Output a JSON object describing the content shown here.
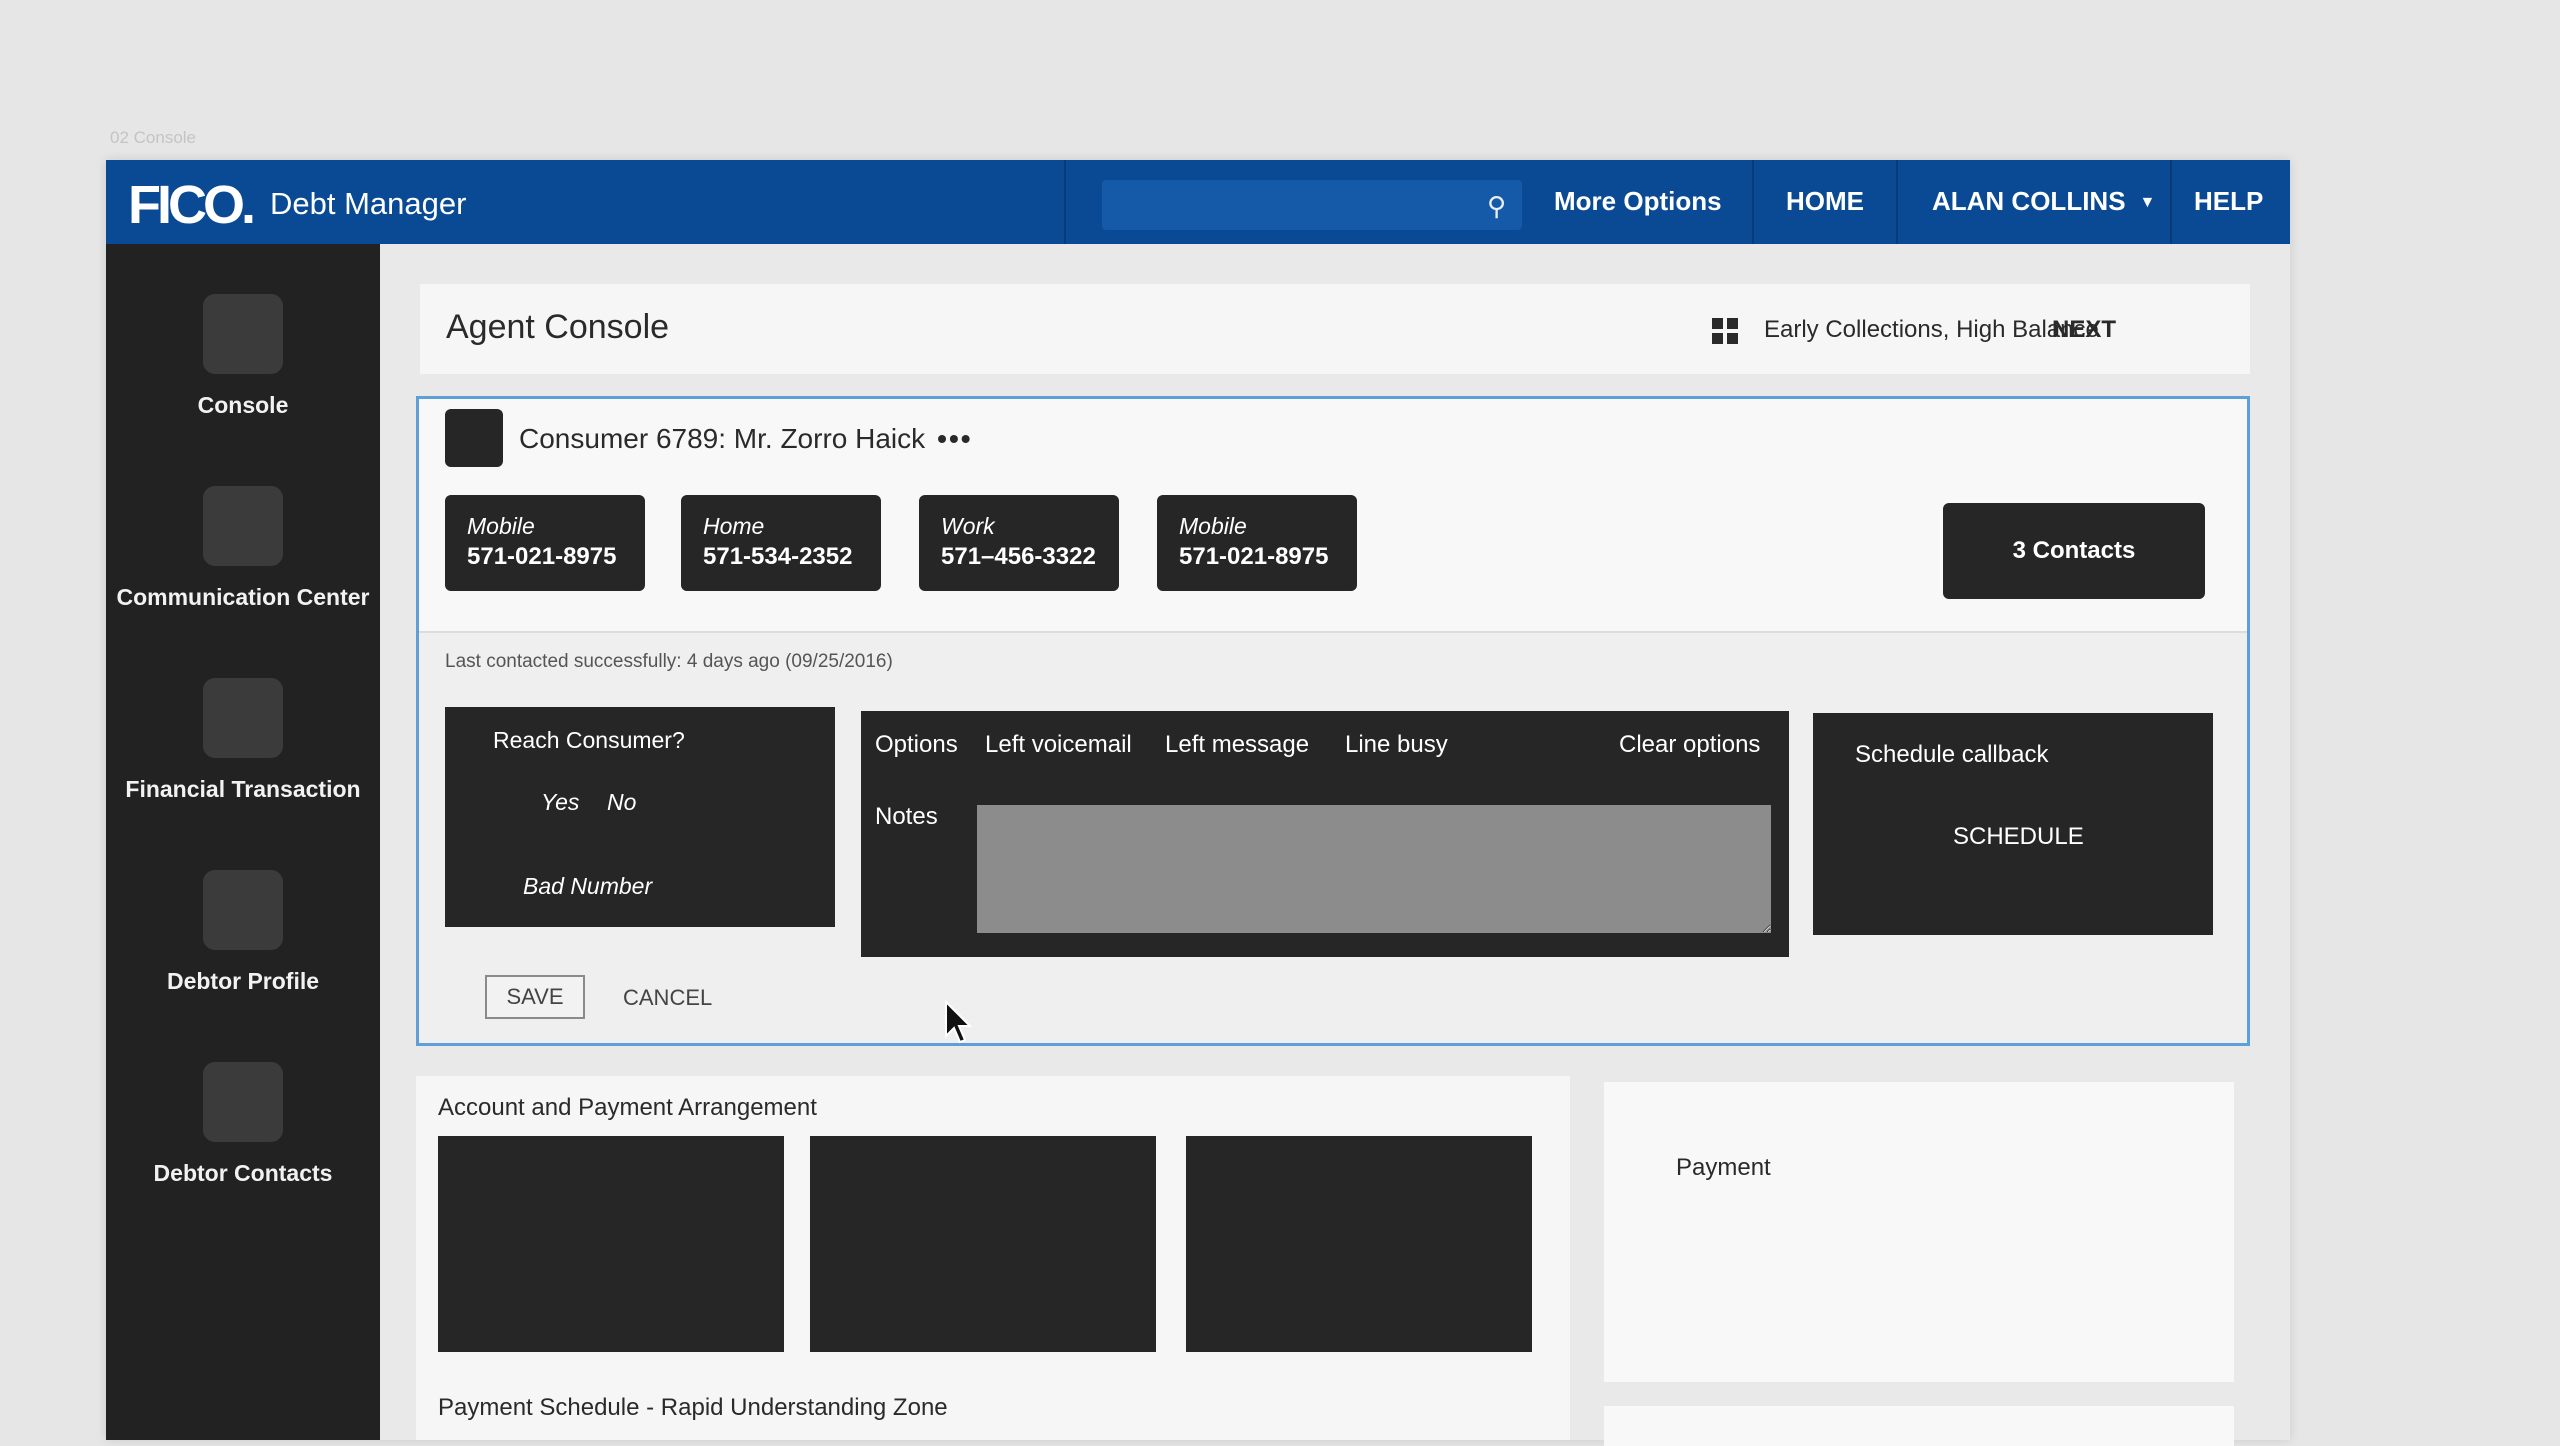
{
  "page_caption": "02 Console",
  "app": {
    "logo": "FICO.",
    "name": "Debt Manager"
  },
  "topbar": {
    "search_placeholder": "",
    "more_options": "More Options",
    "home": "HOME",
    "user": "ALAN COLLINS",
    "help": "HELP"
  },
  "sidebar": {
    "items": [
      {
        "label": "Console",
        "icon": "console-icon"
      },
      {
        "label": "Communication Center",
        "icon": "communication-center-icon"
      },
      {
        "label": "Financial Transaction",
        "icon": "financial-transaction-icon"
      },
      {
        "label": "Debtor Profile",
        "icon": "debtor-profile-icon"
      },
      {
        "label": "Debtor Contacts",
        "icon": "debtor-contacts-icon"
      }
    ]
  },
  "header": {
    "title": "Agent Console",
    "queue": "Early Collections, High Balance",
    "next": "NEXT"
  },
  "consumer": {
    "name": "Consumer 6789: Mr. Zorro Haick",
    "more": "•••",
    "phones": [
      {
        "type": "Mobile",
        "number": "571-021-8975"
      },
      {
        "type": "Home",
        "number": "571-534-2352"
      },
      {
        "type": "Work",
        "number": "571–456-3322"
      },
      {
        "type": "Mobile",
        "number": "571-021-8975"
      }
    ],
    "contacts_button": "3 Contacts",
    "last_contacted": "Last contacted successfully: 4 days ago (09/25/2016)"
  },
  "reach": {
    "title": "Reach Consumer?",
    "yes": "Yes",
    "no": "No",
    "bad_number": "Bad Number"
  },
  "options": {
    "label": "Options",
    "items": [
      "Left voicemail",
      "Left message",
      "Line busy"
    ],
    "clear": "Clear options",
    "notes_label": "Notes",
    "notes_value": ""
  },
  "schedule": {
    "title": "Schedule callback",
    "button": "SCHEDULE"
  },
  "actions": {
    "save": "SAVE",
    "cancel": "CANCEL"
  },
  "account": {
    "title": "Account and Payment Arrangement",
    "schedule_zone_title": "Payment Schedule - Rapid Understanding Zone"
  },
  "payment": {
    "title": "Payment"
  },
  "colors": {
    "brand_blue": "#0a4a94",
    "sidebar": "#222222",
    "tile": "#262626",
    "panel_border": "#5e9fd8"
  }
}
